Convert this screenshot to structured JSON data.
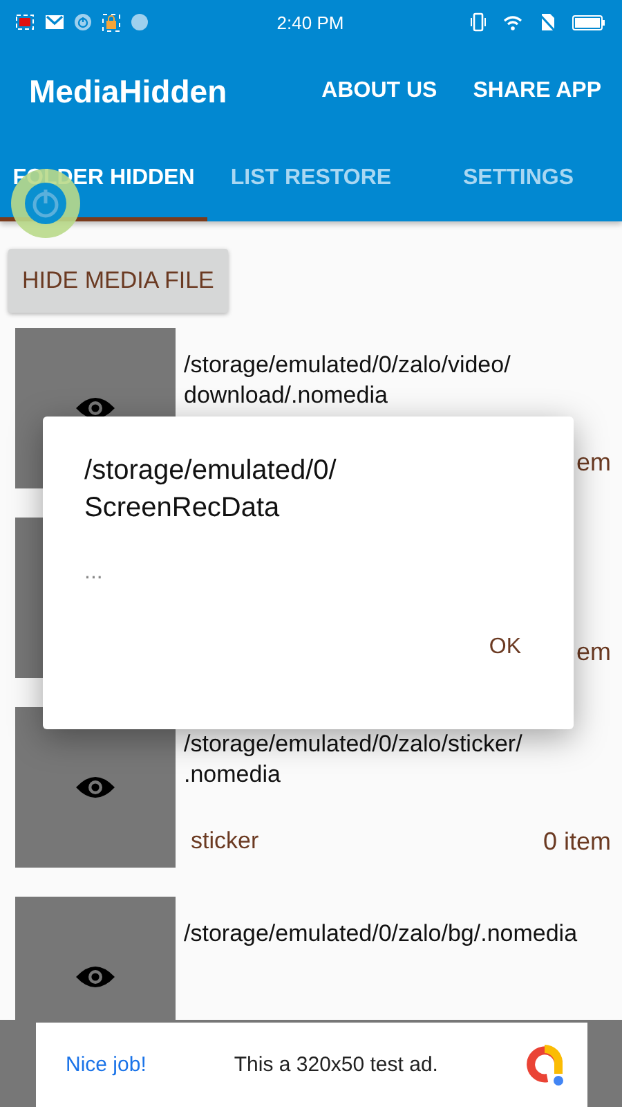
{
  "status_bar": {
    "time": "2:40 PM"
  },
  "app_bar": {
    "title": "MediaHidden",
    "actions": [
      "ABOUT US",
      "SHARE APP"
    ]
  },
  "tabs": [
    {
      "label": "FOLDER HIDDEN",
      "selected": true
    },
    {
      "label": "LIST RESTORE",
      "selected": false
    },
    {
      "label": "SETTINGS",
      "selected": false
    }
  ],
  "hide_button": "HIDE MEDIA FILE",
  "folders": [
    {
      "path": "/storage/emulated/0/zalo/video/download/.nomedia",
      "count": "em"
    },
    {
      "count": "em"
    },
    {
      "path": "/storage/emulated/0/zalo/sticker/.nomedia",
      "label": "sticker",
      "count": "0 item"
    },
    {
      "path": "/storage/emulated/0/zalo/bg/.nomedia"
    }
  ],
  "dialog": {
    "title": "/storage/emulated/0/ScreenRecData",
    "message": "...",
    "button": "OK"
  },
  "ad": {
    "headline": "Nice job!",
    "text": "This a 320x50 test ad."
  }
}
